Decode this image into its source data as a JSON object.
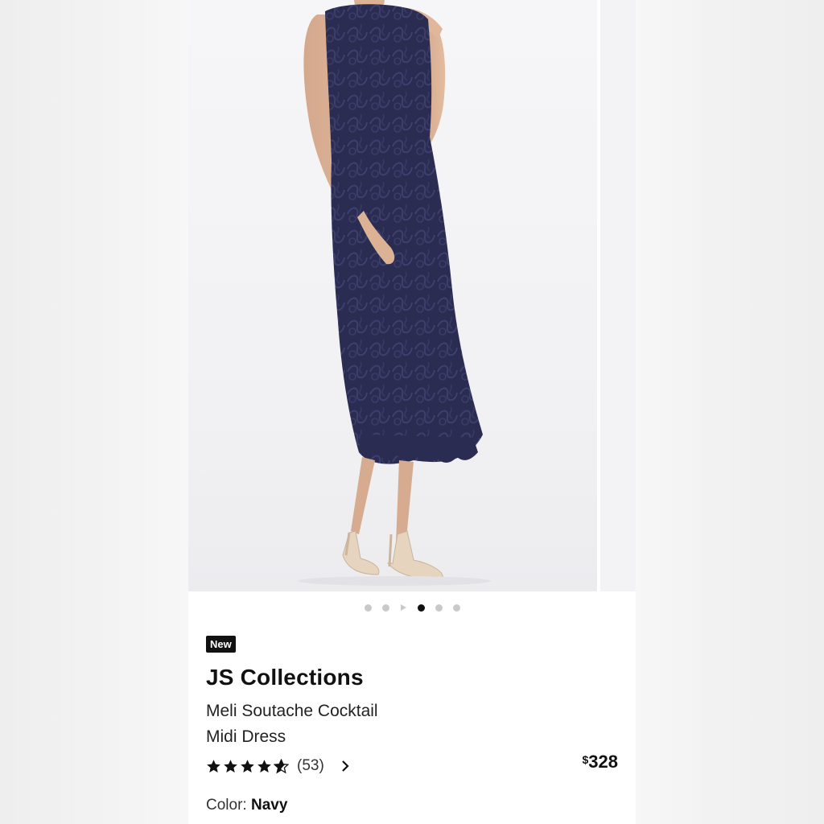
{
  "gallery": {
    "photo_alt": "model wearing navy soutache midi dress",
    "dot_count": 6,
    "active_dot": 3,
    "video_dot": 2
  },
  "product": {
    "badge": "New",
    "brand": "JS Collections",
    "name_line1": "Meli Soutache Cocktail",
    "name_line2": "Midi Dress",
    "rating_value": 4.5,
    "review_count": "(53)",
    "currency": "$",
    "price": "328",
    "color_label": "Color:",
    "color_value": "Navy"
  },
  "colors": {
    "dress": "#2b2c52",
    "badge_bg": "#111111",
    "dot_active": "#111111",
    "dot_inactive": "#c9c9c9"
  },
  "icons": {
    "rating": "star-icon",
    "reviews_link": "chevron-right-icon",
    "video": "play-icon"
  }
}
